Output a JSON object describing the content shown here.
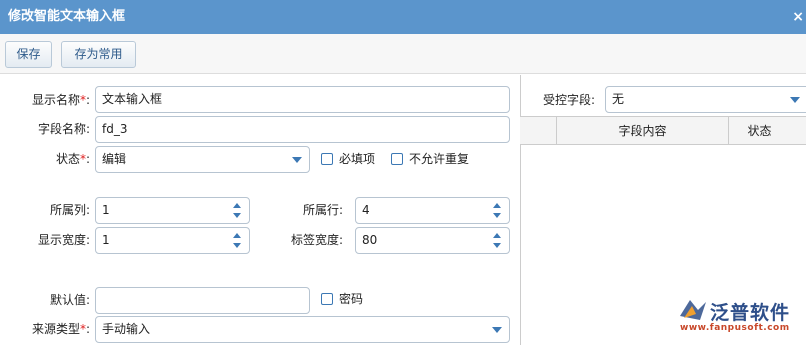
{
  "dialog": {
    "title": "修改智能文本输入框",
    "close_glyph": "×"
  },
  "toolbar": {
    "save_label": "保存",
    "save_common_label": "存为常用"
  },
  "form": {
    "display_name": {
      "label": "显示名称",
      "required": "*",
      "colon": ":",
      "value": "文本输入框"
    },
    "field_name": {
      "label": "字段名称:",
      "value": "fd_3"
    },
    "status": {
      "label": "状态",
      "required": "*",
      "colon": ":",
      "value": "编辑"
    },
    "required_check": {
      "label": "必填项",
      "checked": false
    },
    "no_dup_check": {
      "label": "不允许重复",
      "checked": false
    },
    "column": {
      "label": "所属列:",
      "value": "1"
    },
    "row": {
      "label": "所属行:",
      "value": "4"
    },
    "display_width": {
      "label": "显示宽度:",
      "value": "1"
    },
    "label_width": {
      "label": "标签宽度:",
      "value": "80"
    },
    "default_value": {
      "label": "默认值:",
      "value": ""
    },
    "password_check": {
      "label": "密码",
      "checked": false
    },
    "source_type": {
      "label": "来源类型",
      "required": "*",
      "colon": ":",
      "value": "手动输入"
    }
  },
  "controlled": {
    "label": "受控字段:",
    "value": "无",
    "columns": [
      "字段内容",
      "状态"
    ]
  },
  "logo": {
    "name": "泛普软件",
    "url": "www.fanpusoft.com"
  },
  "colors": {
    "titlebar": "#5b95cc",
    "accent": "#3c78b4",
    "required": "#e02020"
  }
}
